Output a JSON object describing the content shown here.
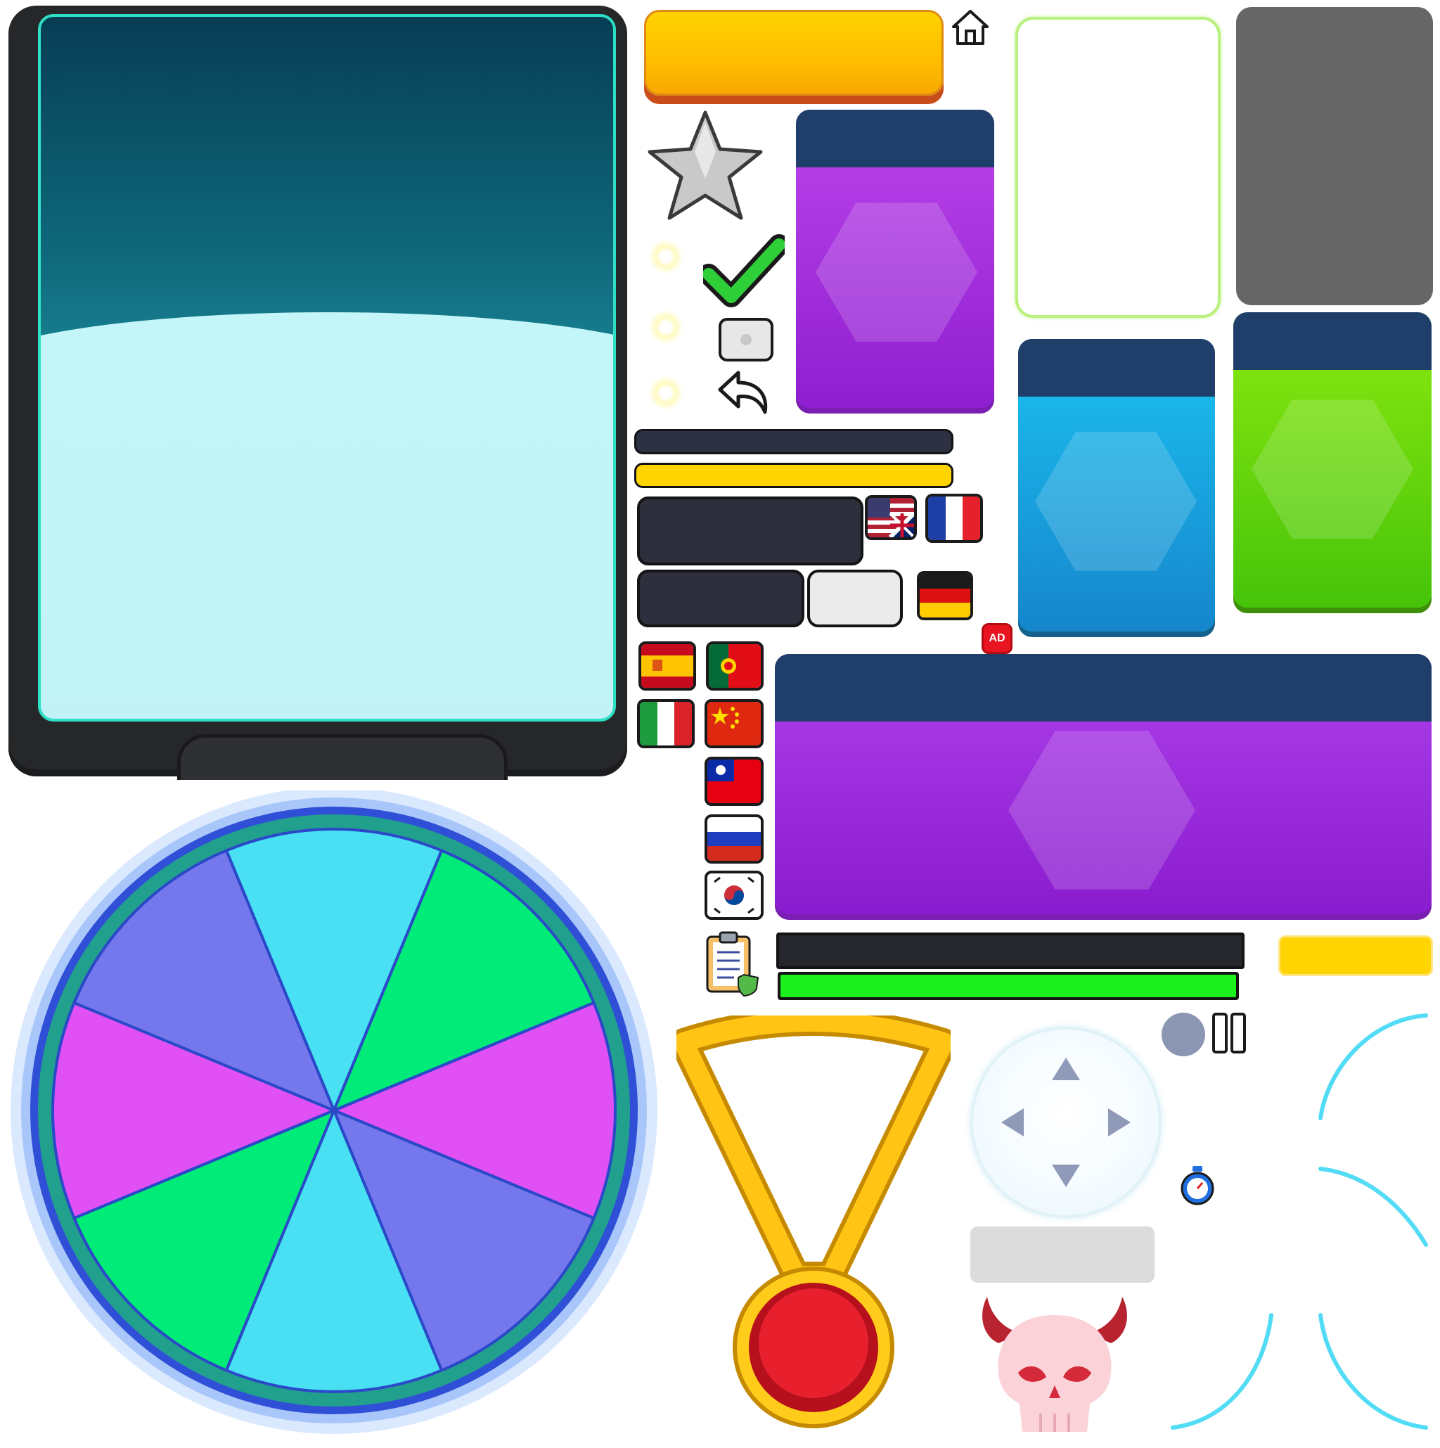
{
  "sheet": {
    "ad_badge_label": "AD"
  },
  "tablet_panel": {
    "screen_color": "#2de0c5"
  },
  "prize_wheel": {
    "segments": [
      "cyan",
      "green",
      "magenta",
      "purple",
      "cyan",
      "green",
      "magenta",
      "purple"
    ],
    "colors": {
      "cyan": "#48e0f2",
      "green": "#00eb78",
      "magenta": "#e050f4",
      "purple": "#7478ec"
    }
  },
  "buttons": {
    "primary_color": "#ffc200",
    "home_icon": "home-icon",
    "back_icon": "back-arrow-icon",
    "check_icon": "checkmark-icon",
    "star_icon": "star-icon",
    "pause_icon": "pause-icon",
    "timer_icon": "stopwatch-icon",
    "clipboard_icon": "clipboard-check-icon",
    "skull_icon": "devil-skull-icon"
  },
  "progress_bars": {
    "top_fill": 1.0,
    "bottom_fill": 1.0,
    "colors": {
      "track": "#2e3141",
      "yellow": "#ffd400",
      "green": "#1cf01c"
    }
  },
  "card_colors": {
    "purple": "#9a27dc",
    "blue": "#1aa8e0",
    "green": "#66d60c",
    "header": "#1f3e6a"
  },
  "flags": [
    "us-uk",
    "france",
    "germany",
    "spain",
    "portugal",
    "italy",
    "china",
    "taiwan",
    "russia",
    "korea"
  ]
}
